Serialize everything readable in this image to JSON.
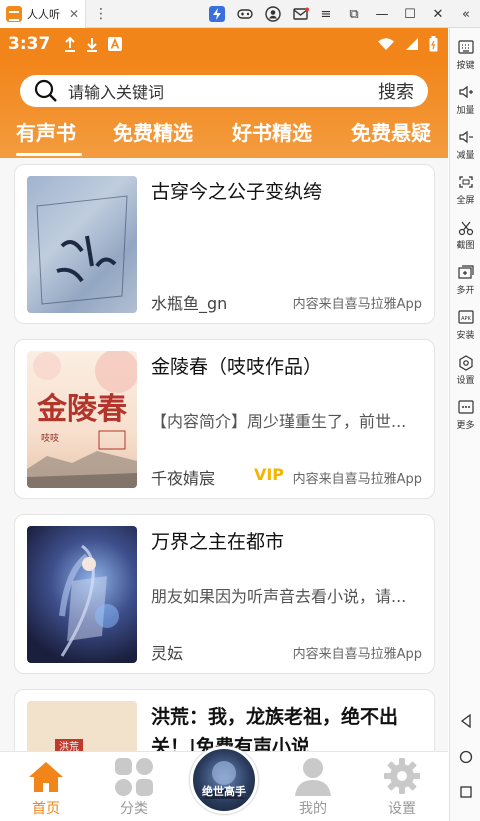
{
  "emulator": {
    "tab_title": "人人听",
    "close_glyph": "✕",
    "menu_glyph": "⋮",
    "window_controls": [
      "≡",
      "⧉",
      "—",
      "☐",
      "✕"
    ],
    "collapse_glyph": "«"
  },
  "sidebar": [
    {
      "label": "按键",
      "icon": "keyboard-icon"
    },
    {
      "label": "加量",
      "icon": "volume-up-icon"
    },
    {
      "label": "减量",
      "icon": "volume-down-icon"
    },
    {
      "label": "全屏",
      "icon": "fullscreen-icon"
    },
    {
      "label": "截图",
      "icon": "scissors-icon"
    },
    {
      "label": "多开",
      "icon": "multi-instance-icon"
    },
    {
      "label": "安装",
      "icon": "apk-install-icon"
    },
    {
      "label": "设置",
      "icon": "settings-icon"
    },
    {
      "label": "更多",
      "icon": "more-icon"
    }
  ],
  "status_bar": {
    "time": "3:37"
  },
  "search": {
    "placeholder": "请输入关键词",
    "button": "搜索"
  },
  "tabs": [
    "有声书",
    "免费精选",
    "好书精选",
    "免费悬疑"
  ],
  "books": [
    {
      "title": "古穿今之公子变纨绔",
      "description": "",
      "author": "水瓶鱼_gn",
      "source": "内容来自喜马拉雅App",
      "vip": ""
    },
    {
      "title": "金陵春（吱吱作品）",
      "description": "【内容简介】周少瑾重生了，前世...",
      "author": "千夜婧宸",
      "source": "内容来自喜马拉雅App",
      "vip": "VIP",
      "cover_text": {
        "main": "金陵春",
        "small": "吱吱"
      }
    },
    {
      "title": "万界之主在都市",
      "description": "朋友如果因为听声音去看小说，请...",
      "author": "灵妘",
      "source": "内容来自喜马拉雅App",
      "vip": ""
    },
    {
      "title": "洪荒：我，龙族老祖，绝不出关！|免费有声小说",
      "description": "",
      "author": "",
      "source": "",
      "vip": "",
      "cover_text": {
        "main": "洪荒"
      }
    }
  ],
  "bottom_nav": [
    {
      "label": "首页",
      "icon": "home-icon",
      "active": true
    },
    {
      "label": "分类",
      "icon": "category-icon",
      "active": false
    },
    {
      "label": "",
      "icon": "now-playing-disc",
      "active": false
    },
    {
      "label": "我的",
      "icon": "profile-icon",
      "active": false
    },
    {
      "label": "设置",
      "icon": "gear-icon",
      "active": false
    }
  ],
  "center_disc_text": "绝世高手",
  "colors": {
    "accent": "#f28519",
    "vip": "#f4b400"
  }
}
